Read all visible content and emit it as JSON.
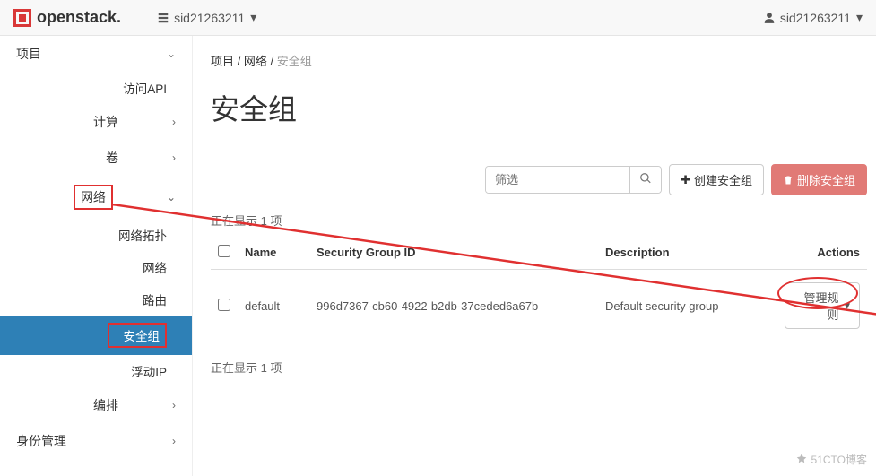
{
  "brand": "openstack",
  "project_indicator": "sid21263211",
  "user_indicator": "sid21263211",
  "sidebar": {
    "project": "项目",
    "api": "访问API",
    "compute": "计算",
    "volumes": "卷",
    "network": "网络",
    "network_topology": "网络拓扑",
    "networks": "网络",
    "routers": "路由",
    "security_groups": "安全组",
    "floating_ips": "浮动IP",
    "orchestration": "编排",
    "identity": "身份管理"
  },
  "breadcrumb": {
    "a": "项目",
    "b": "网络",
    "c": "安全组"
  },
  "page_title": "安全组",
  "filter_placeholder": "筛选",
  "btn_create": "创建安全组",
  "btn_delete": "删除安全组",
  "summary_top": "正在显示 1 项",
  "summary_bottom": "正在显示 1 项",
  "columns": {
    "name": "Name",
    "sgid": "Security Group ID",
    "desc": "Description",
    "actions": "Actions"
  },
  "rows": [
    {
      "name": "default",
      "sgid": "996d7367-cb60-4922-b2db-37ceded6a67b",
      "desc": "Default security group",
      "action": "管理规则"
    }
  ],
  "watermark": "51CTO博客"
}
